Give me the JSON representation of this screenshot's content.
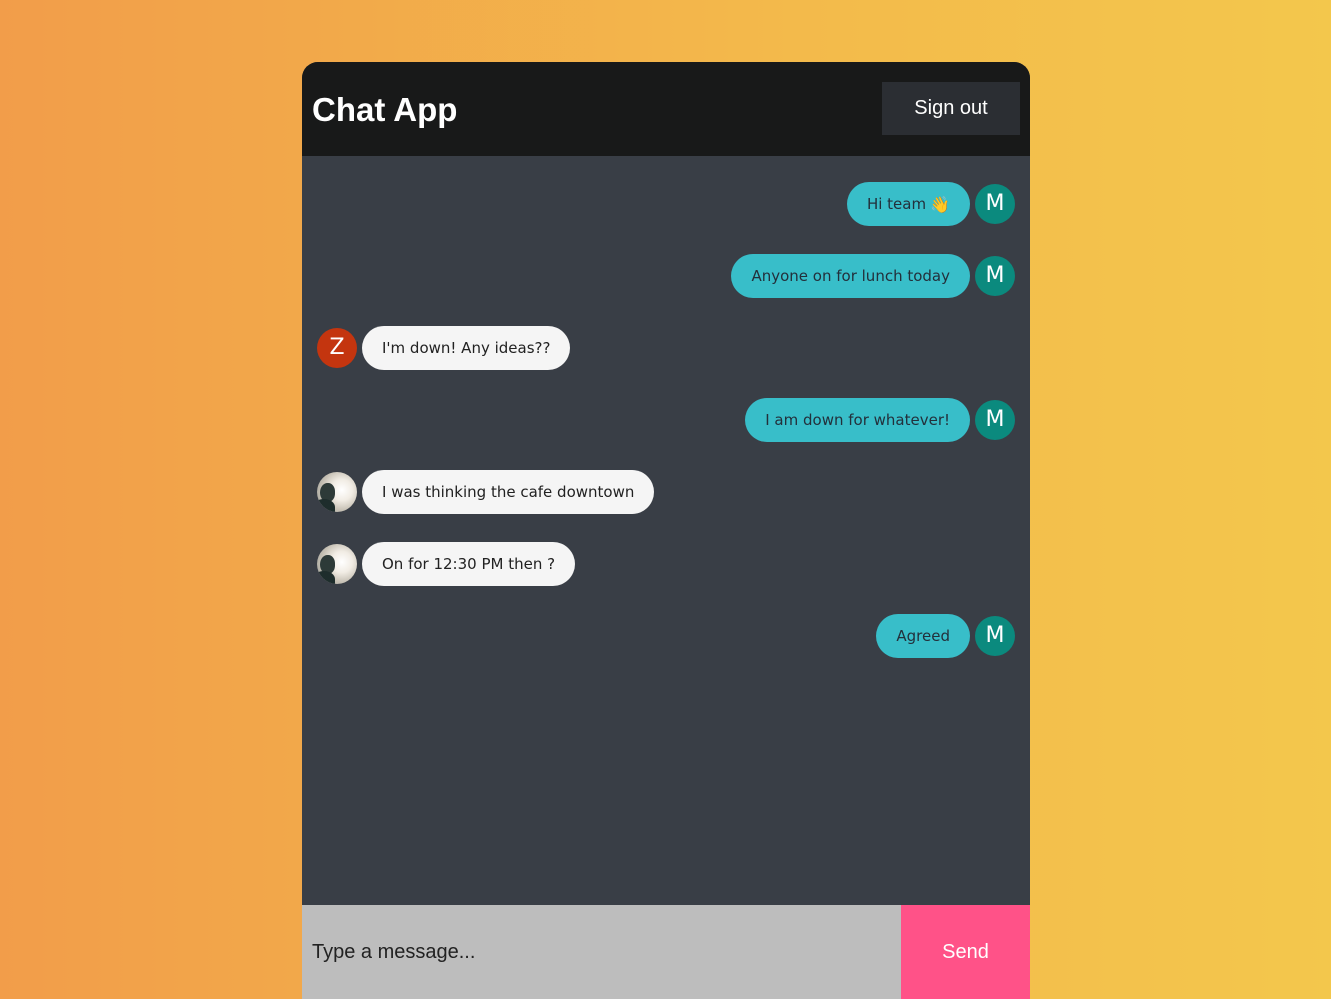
{
  "header": {
    "title": "Chat App",
    "sign_out_label": "Sign out"
  },
  "colors": {
    "header_bg": "#181919",
    "chat_bg": "#393e46",
    "sent_bubble": "#38bec9",
    "received_bubble": "#f5f5f5",
    "self_avatar": "#0b8a7e",
    "z_avatar": "#c4350f",
    "send_button": "#ff5288",
    "input_bg": "#bdbdbd"
  },
  "messages": [
    {
      "text": "Hi team",
      "emoji": "👋",
      "avatar": "M",
      "direction": "sent"
    },
    {
      "text": "Anyone on for lunch today",
      "avatar": "M",
      "direction": "sent"
    },
    {
      "text": "I'm down! Any ideas??",
      "avatar": "Z",
      "direction": "received"
    },
    {
      "text": "I am down for whatever!",
      "avatar": "M",
      "direction": "sent"
    },
    {
      "text": "I was thinking the cafe downtown",
      "avatar_icon": "user-photo-icon",
      "direction": "received"
    },
    {
      "text": "On for 12:30 PM then ?",
      "avatar_icon": "user-photo-icon",
      "direction": "received"
    },
    {
      "text": "Agreed",
      "avatar": "M",
      "direction": "sent"
    }
  ],
  "composer": {
    "placeholder": "Type a message...",
    "value": "",
    "send_label": "Send"
  }
}
